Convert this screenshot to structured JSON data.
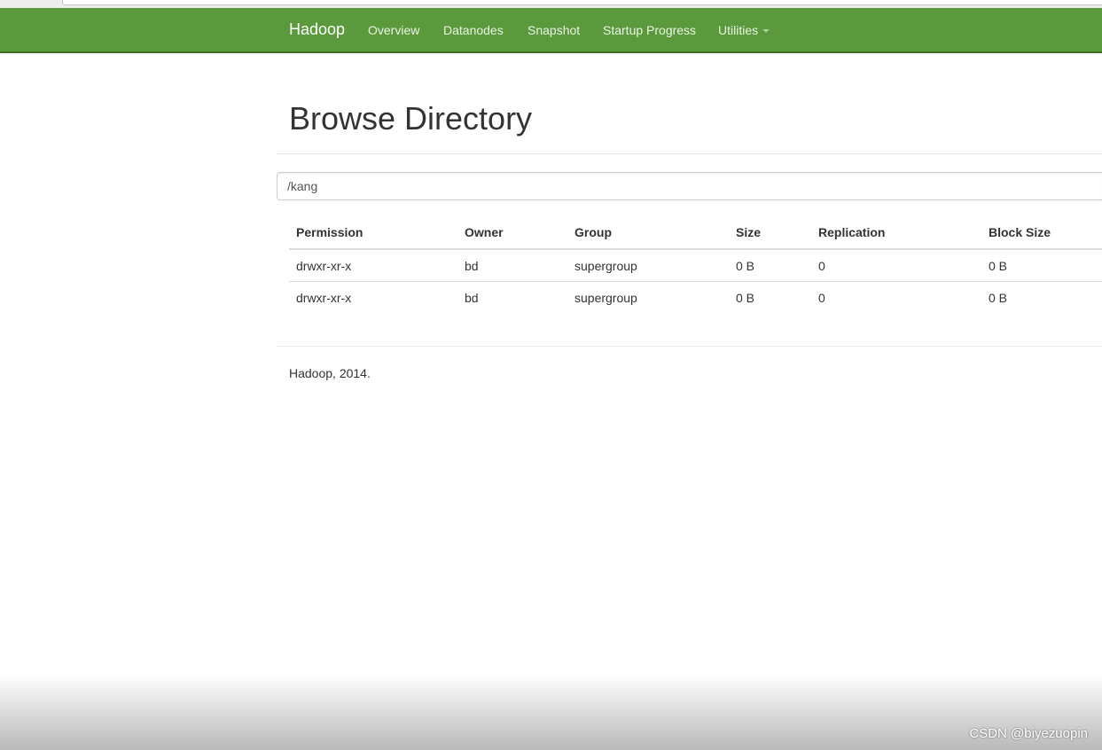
{
  "navbar": {
    "brand": "Hadoop",
    "links": [
      "Overview",
      "Datanodes",
      "Snapshot",
      "Startup Progress"
    ],
    "utilities_label": "Utilities",
    "background_color": "#5b9a3c"
  },
  "page": {
    "title": "Browse Directory"
  },
  "path_input": {
    "value": "/kang"
  },
  "table": {
    "headers": [
      "Permission",
      "Owner",
      "Group",
      "Size",
      "Replication",
      "Block Size"
    ],
    "rows": [
      [
        "drwxr-xr-x",
        "bd",
        "supergroup",
        "0 B",
        "0",
        "0 B"
      ],
      [
        "drwxr-xr-x",
        "bd",
        "supergroup",
        "0 B",
        "0",
        "0 B"
      ]
    ]
  },
  "footer": {
    "text": "Hadoop, 2014."
  },
  "watermark": {
    "text": "CSDN @biyezuopin"
  }
}
